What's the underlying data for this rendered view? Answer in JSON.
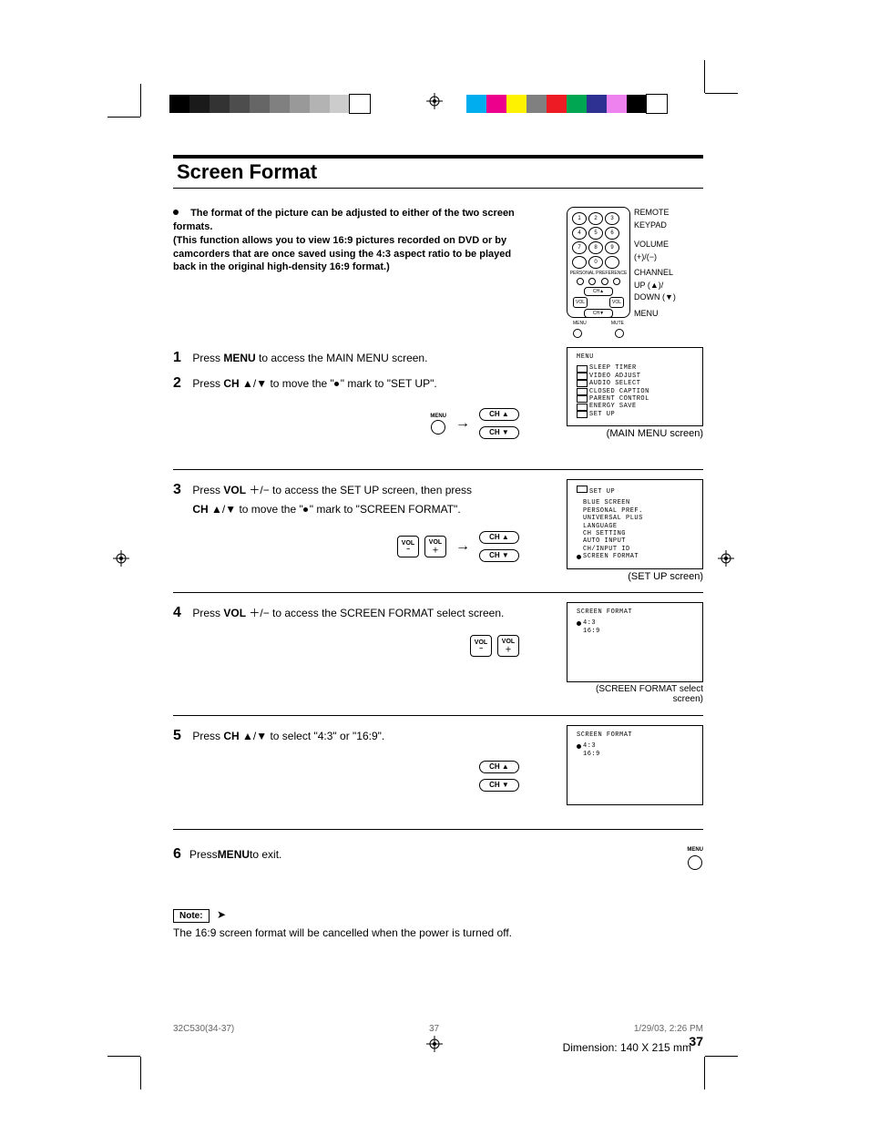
{
  "title": "Screen Format",
  "intro": {
    "line1": "The format of the picture can be adjusted to either of the two screen formats.",
    "line2": "(This function allows you to view 16:9 pictures recorded on DVD or by camcorders that are once saved using the 4:3 aspect ratio to be played back in the original high-density 16:9 format.)"
  },
  "remote": {
    "label1": "REMOTE",
    "label2": "KEYPAD",
    "label3": "VOLUME",
    "label4": "(+)/(−)",
    "label5": "CHANNEL",
    "label6": "UP (▲)/",
    "label7": "DOWN (▼)",
    "label8": "MENU",
    "keys": [
      "1",
      "2",
      "3",
      "4",
      "5",
      "6",
      "7",
      "8",
      "9",
      "",
      "0",
      ""
    ],
    "pp": "PERSONAL PREFERENCE",
    "ch_up": "CH▲",
    "ch_dn": "CH▼",
    "vol_minus": "VOL",
    "vol_plus": "VOL",
    "menu": "MENU",
    "mute": "MUTE"
  },
  "steps": {
    "s1": {
      "num": "1",
      "text_a": "Press ",
      "bold_a": "MENU",
      "text_b": " to access the MAIN MENU screen."
    },
    "s2": {
      "num": "2",
      "text_a": "Press ",
      "bold_a": "CH",
      "text_b": " ▲/▼ to move the \"",
      "text_c": "\" mark to \"SET UP\"."
    },
    "s3": {
      "num": "3",
      "text_a": "Press ",
      "bold_a": "VOL",
      "text_b": " ＋/− to access the SET UP screen, then press",
      "text_c": "CH",
      "text_d": " ▲/▼ to move the \"",
      "text_e": "\" mark to \"SCREEN FORMAT\"."
    },
    "s4": {
      "num": "4",
      "text_a": "Press ",
      "bold_a": "VOL",
      "text_b": " ＋/− to access the SCREEN FORMAT select screen."
    },
    "s5": {
      "num": "5",
      "text_a": "Press ",
      "bold_a": "CH",
      "text_b": " ▲/▼ to select \"4:3\" or \"16:9\"."
    },
    "s6": {
      "num": "6",
      "text_a": "Press ",
      "bold_a": "MENU",
      "text_b": " to exit."
    }
  },
  "controls": {
    "menu": "MENU",
    "ch_up": "CH ▲",
    "ch_dn": "CH ▼",
    "vol_minus_a": "VOL",
    "vol_minus_b": "−",
    "vol_plus_a": "VOL",
    "vol_plus_b": "＋"
  },
  "screens": {
    "main": {
      "title": "MENU",
      "items": [
        "SLEEP TIMER",
        "VIDEO ADJUST",
        "AUDIO SELECT",
        "CLOSED CAPTION",
        "PARENT CONTROL",
        "ENERGY SAVE",
        "SET UP"
      ],
      "caption": "(MAIN MENU screen)"
    },
    "setup": {
      "title": "SET UP",
      "items": [
        "BLUE SCREEN",
        "PERSONAL PREF.",
        "UNIVERSAL PLUS",
        "LANGUAGE",
        "CH SETTING",
        "AUTO INPUT",
        "CH/INPUT ID",
        "SCREEN FORMAT"
      ],
      "caption": "(SET UP screen)"
    },
    "sf1": {
      "title": "SCREEN FORMAT",
      "items": [
        "4:3",
        "16:9"
      ],
      "caption": "(SCREEN FORMAT select screen)"
    },
    "sf2": {
      "title": "SCREEN FORMAT",
      "items": [
        "4:3",
        "16:9"
      ]
    }
  },
  "note": {
    "label": "Note:",
    "text": "The 16:9 screen format will be cancelled when the power is turned off."
  },
  "pagenum": "37",
  "footer": {
    "left": "32C530(34-37)",
    "mid": "37",
    "right": "1/29/03, 2:26 PM"
  },
  "dimension": "Dimension: 140  X 215 mm",
  "gray_swatches": [
    "#000000",
    "#1a1a1a",
    "#333333",
    "#4d4d4d",
    "#666666",
    "#808080",
    "#999999",
    "#b3b3b3",
    "#cccccc",
    "#ffffff"
  ],
  "color_swatches": [
    "#00aeef",
    "#ec008c",
    "#fff200",
    "#808080",
    "#ed1c24",
    "#00a651",
    "#2e3192",
    "#ee82ee",
    "#000000",
    "#ffffff"
  ]
}
